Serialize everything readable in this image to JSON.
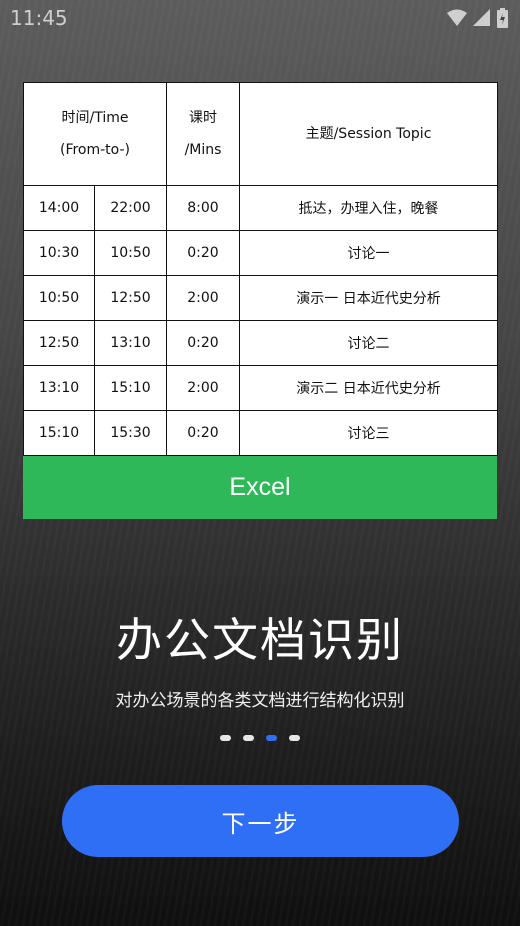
{
  "status_bar": {
    "time": "11:45"
  },
  "document_preview": {
    "header": {
      "time_col": "时间/Time\n(From-to-)",
      "mins_col": "课时\n/Mins",
      "topic_col": "主题/Session Topic"
    },
    "rows": [
      {
        "from": "14:00",
        "to": "22:00",
        "mins": "8:00",
        "topic": "抵达，办理入住，晚餐"
      },
      {
        "from": "10:30",
        "to": "10:50",
        "mins": "0:20",
        "topic": "讨论一"
      },
      {
        "from": "10:50",
        "to": "12:50",
        "mins": "2:00",
        "topic": "演示一 日本近代史分析"
      },
      {
        "from": "12:50",
        "to": "13:10",
        "mins": "0:20",
        "topic": "讨论二"
      },
      {
        "from": "13:10",
        "to": "15:10",
        "mins": "2:00",
        "topic": "演示二 日本近代史分析"
      },
      {
        "from": "15:10",
        "to": "15:30",
        "mins": "0:20",
        "topic": "讨论三"
      }
    ],
    "format_label": "Excel",
    "format_color": "#2fb85a"
  },
  "intro": {
    "title": "办公文档识别",
    "subtitle": "对办公场景的各类文档进行结构化识别"
  },
  "pager": {
    "total": 4,
    "active_index": 2
  },
  "next_button_label": "下一步",
  "accent_color": "#2f6ff5"
}
